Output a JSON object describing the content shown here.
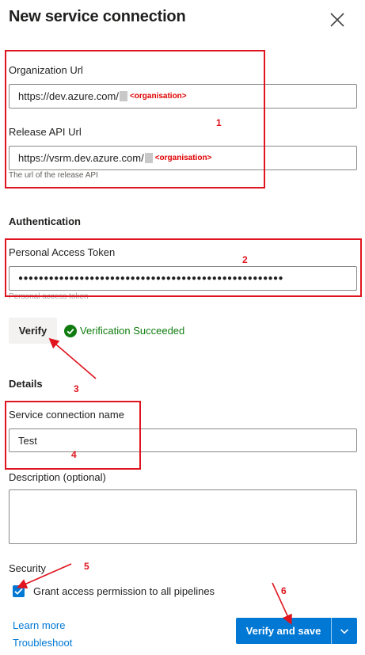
{
  "header": {
    "title": "New service connection",
    "close_icon": "close-icon"
  },
  "connection": {
    "org_url_label": "Organization Url",
    "org_url_prefix": "https://dev.azure.com/",
    "org_url_placeholder_tag": "<organisation>",
    "release_api_label": "Release API Url",
    "release_api_prefix": "https://vsrm.dev.azure.com/",
    "release_api_placeholder_tag": "<organisation>",
    "release_api_hint": "The url of the release API"
  },
  "authentication": {
    "section_title": "Authentication",
    "pat_label": "Personal Access Token",
    "pat_value": "●●●●●●●●●●●●●●●●●●●●●●●●●●●●●●●●●●●●●●●●●●●●●●●●●●●●",
    "pat_hint": "Personal access token",
    "verify_button": "Verify",
    "verification_status": "Verification Succeeded"
  },
  "details": {
    "section_title": "Details",
    "name_label": "Service connection name",
    "name_value": "Test",
    "description_label": "Description (optional)",
    "description_value": ""
  },
  "security": {
    "section_title": "Security",
    "grant_access_label": "Grant access permission to all pipelines",
    "grant_access_checked": true
  },
  "footer": {
    "learn_more": "Learn more",
    "troubleshoot": "Troubleshoot",
    "verify_and_save": "Verify and save"
  },
  "annotations": {
    "n1": "1",
    "n2": "2",
    "n3": "3",
    "n4": "4",
    "n5": "5",
    "n6": "6"
  },
  "colors": {
    "primary": "#0078d4",
    "success": "#107c10",
    "annotation_red": "#e0141e"
  }
}
